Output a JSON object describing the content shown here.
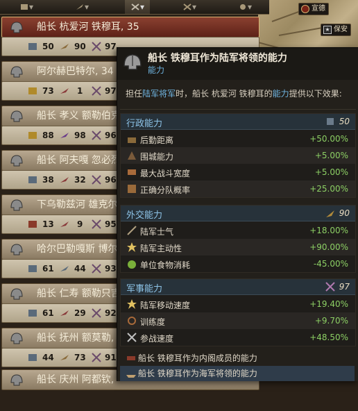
{
  "map": {
    "labels": [
      {
        "text": "宣德"
      },
      {
        "text": "保安"
      }
    ]
  },
  "tabs": [
    "▾",
    "▾",
    "▾",
    "▾",
    "▾"
  ],
  "rows": [
    {
      "name": "船长 杭爱河 铁穆耳, 35",
      "prefix_stats": [
        "50",
        "90",
        "97"
      ],
      "selected": true
    },
    {
      "name": "阿尔赫巴特尔, 34",
      "prefix_stats": [
        "73",
        "1",
        "97"
      ],
      "selected": false
    },
    {
      "name": "船长 孝义 额勒伯克",
      "prefix_stats": [
        "88",
        "98",
        "96"
      ],
      "selected": false
    },
    {
      "name": "船长 阿夫嘎 忽必烈",
      "prefix_stats": [
        "38",
        "32",
        "96"
      ],
      "selected": false
    },
    {
      "name": "下乌勒兹河 雄克尔",
      "prefix_stats": [
        "13",
        "9",
        "95"
      ],
      "selected": false
    },
    {
      "name": "哈尔巴勒嘎斯 博尔",
      "prefix_stats": [
        "61",
        "44",
        "93"
      ],
      "selected": false
    },
    {
      "name": "船长 仁寿 额勒只吉",
      "prefix_stats": [
        "61",
        "29",
        "92"
      ],
      "selected": false
    },
    {
      "name": "船长 抚州 额莫勒,",
      "prefix_stats": [
        "44",
        "73",
        "91"
      ],
      "selected": false
    },
    {
      "name": "船长 庆州 阿都钦,",
      "prefix_stats": [],
      "selected": false
    }
  ],
  "tooltip": {
    "title": "船长 铁穆耳作为陆军将领的能力",
    "subtitle": "能力",
    "desc_pre": "担任",
    "desc_role": "陆军将军",
    "desc_mid": "时，船长 杭爱河 铁穆耳的",
    "desc_ability": "能力",
    "desc_post": "提供以下效果:",
    "sections": [
      {
        "title": "行政能力",
        "value": "50",
        "effects": [
          {
            "label": "后勤距离",
            "value": "+50.00%"
          },
          {
            "label": "围城能力",
            "value": "+5.00%"
          },
          {
            "label": "最大战斗宽度",
            "value": "+5.00%"
          },
          {
            "label": "正确分队概率",
            "value": "+25.00%"
          }
        ]
      },
      {
        "title": "外交能力",
        "value": "90",
        "effects": [
          {
            "label": "陆军士气",
            "value": "+18.00%"
          },
          {
            "label": "陆军主动性",
            "value": "+90.00%"
          },
          {
            "label": "单位食物消耗",
            "value": "-45.00%"
          }
        ]
      },
      {
        "title": "军事能力",
        "value": "97",
        "effects": [
          {
            "label": "陆军移动速度",
            "value": "+19.40%"
          },
          {
            "label": "训练度",
            "value": "+9.70%"
          },
          {
            "label": "参战速度",
            "value": "+48.50%"
          }
        ]
      }
    ],
    "footer": [
      {
        "label": "船长 铁穆耳作为内阁成员的能力"
      },
      {
        "label": "船长 铁穆耳作为海军将领的能力"
      }
    ]
  }
}
